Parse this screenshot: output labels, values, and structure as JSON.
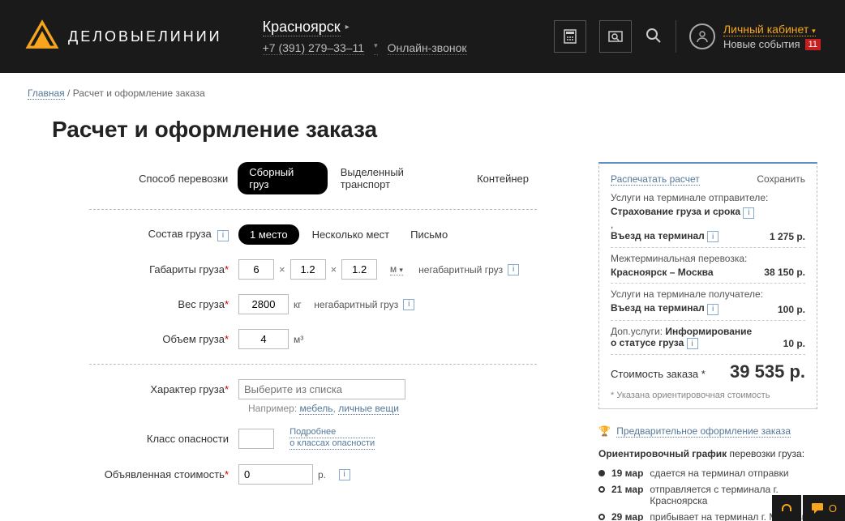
{
  "header": {
    "city": "Красноярск",
    "phone": "+7 (391) 279–33–11",
    "online_call": "Онлайн-звонок",
    "account": "Личный кабинет",
    "events": "Новые события",
    "events_count": "11",
    "logo_text": "ДЕЛОВЫЕЛИНИИ"
  },
  "crumbs": {
    "home": "Главная",
    "sep": " / ",
    "page": "Расчет и оформление заказа"
  },
  "title": "Расчет и оформление заказа",
  "form": {
    "transport_label": "Способ перевозки",
    "transport_opts": {
      "a": "Сборный груз",
      "b": "Выделенный транспорт",
      "c": "Контейнер"
    },
    "sostav_label": "Состав груза",
    "sostav_opts": {
      "a": "1 место",
      "b": "Несколько мест",
      "c": "Письмо"
    },
    "dims_label": "Габариты груза",
    "dims": {
      "l": "6",
      "w": "1.2",
      "h": "1.2",
      "unit": "м",
      "over": "негабаритный груз"
    },
    "weight_label": "Вес груза",
    "weight": {
      "v": "2800",
      "unit": "кг",
      "over": "негабаритный груз"
    },
    "volume_label": "Объем груза",
    "volume": {
      "v": "4",
      "unit": "м³"
    },
    "nature_label": "Характер груза",
    "nature_placeholder": "Выберите из списка",
    "nature_hint_prefix": "Например: ",
    "nature_hint_a": "мебель",
    "nature_hint_b": "личные вещи",
    "hazard_label": "Класс опасности",
    "hazard_more_1": "Подробнее",
    "hazard_more_2": "о классах опасности",
    "declared_label": "Объявленная стоимость",
    "declared_value": "0",
    "declared_unit": "р."
  },
  "summary": {
    "print": "Распечатать расчет",
    "save": "Сохранить",
    "s1_title": "Услуги на терминале отправителе:",
    "s1_line1": "Страхование груза и срока",
    "s1_line2": "Въезд на терминал",
    "s1_price": "1 275 р.",
    "s2_title": "Межтерминальная перевозка:",
    "s2_route": "Красноярск – Москва",
    "s2_price": "38 150 р.",
    "s3_title": "Услуги на терминале получателе:",
    "s3_line": "Въезд на терминал",
    "s3_price": "100 р.",
    "s4_title_a": "Доп.услуги: ",
    "s4_title_b": "Информирование о статусе груза",
    "s4_price": "10 р.",
    "total_label": "Стоимость заказа *",
    "total_value": "39 535 р.",
    "footnote_a": "* Указана ",
    "footnote_b": "ориентировочная стоимость"
  },
  "prelim": "Предварительное оформление заказа",
  "schedule": {
    "title_a": "Ориентировочный график ",
    "title_b": "перевозки груза:",
    "r1_date": "19 мар",
    "r1_txt": "сдается на терминал отправки",
    "r2_date": "21 мар",
    "r2_txt": "отправляется с терминала г. Красноярска",
    "r3_date": "29 мар",
    "r3_txt": "прибывает на терминал г. Москвы"
  },
  "fab": {
    "chat": "О"
  }
}
